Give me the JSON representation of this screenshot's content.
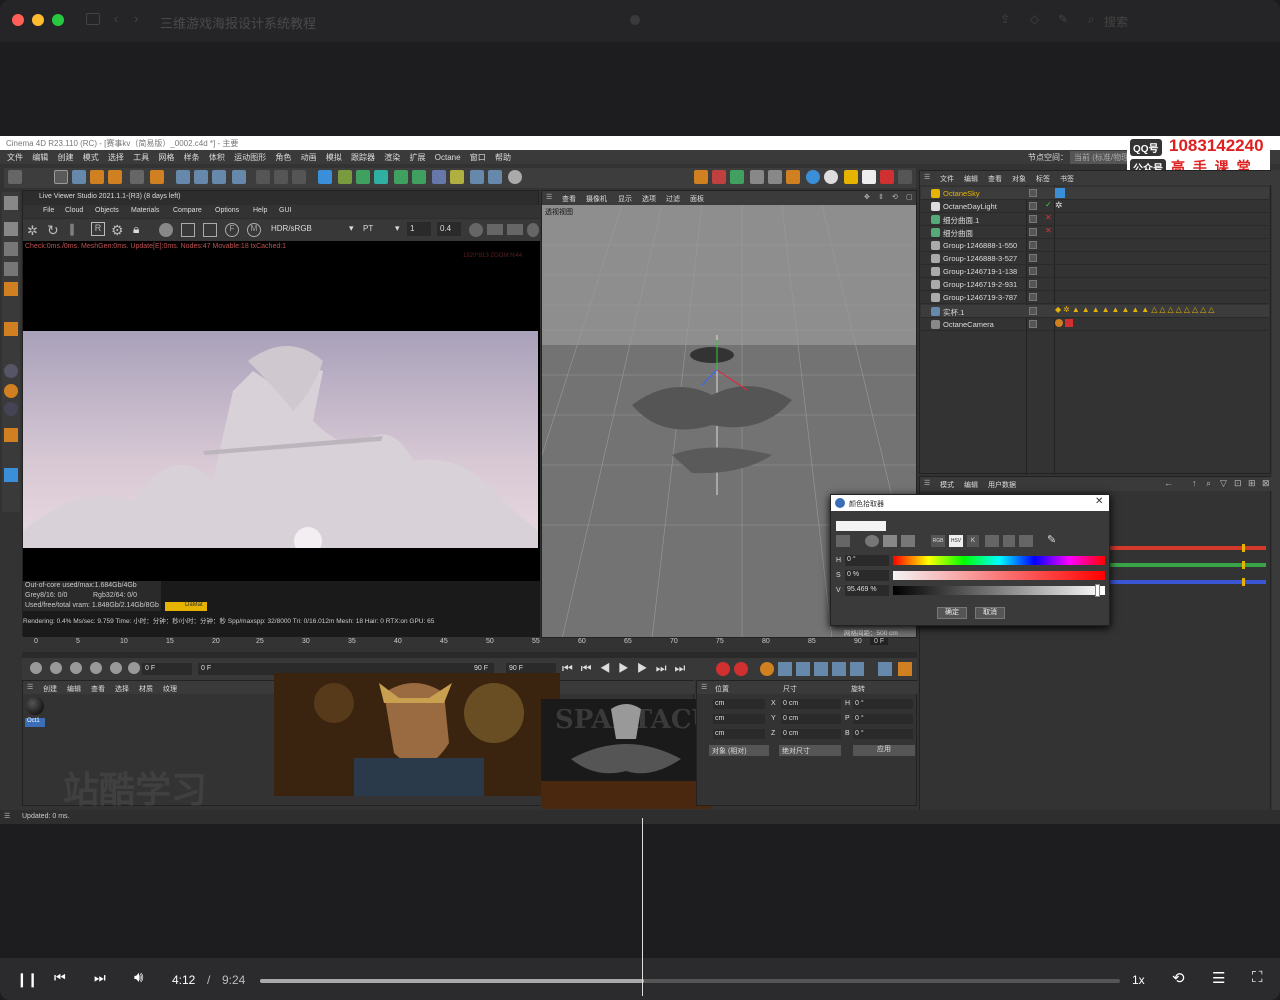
{
  "window": {
    "title": "三维游戏海报设计系统教程",
    "search_placeholder": "搜索"
  },
  "c4d": {
    "title": "Cinema 4D R23.110 (RC) - [赛事kv（简易版）_0002.c4d *] - 主要",
    "menu": [
      "文件",
      "编辑",
      "创建",
      "模式",
      "选择",
      "工具",
      "网格",
      "样条",
      "体积",
      "运动图形",
      "角色",
      "动画",
      "模拟",
      "跟踪器",
      "渲染",
      "扩展",
      "Octane",
      "窗口",
      "帮助"
    ],
    "node_space_label": "节点空间：",
    "node_space_value": "当前 (标准/物理)"
  },
  "watermark_badge": {
    "qq_label": "QQ号",
    "qq_number": "1083142240",
    "wechat_label": "公众号",
    "wechat_name": "高 手 课 堂"
  },
  "live_viewer": {
    "title": "Live Viewer Studio 2021.1.1-(R3) (8 days left)",
    "menu": [
      "File",
      "Cloud",
      "Objects",
      "Materials",
      "Compare",
      "Options",
      "Help",
      "GUI"
    ],
    "color_space": "HDR/sRGB",
    "mode": "PT",
    "value1": "1",
    "value2": "0.4",
    "status": "Check:0ms./0ms. MeshGen:0ms. Update[E]:0ms. Nodes:47 Movable:18 txCached:1",
    "zoom_text": "1920*813 ZOOM:%44",
    "stats": [
      "Out-of-core used/max:1.684Gb/4Gb",
      "Grey8/16: 0/0",
      "Rgb32/64: 0/0",
      "Used/free/total vram: 1.848Gb/2.14Gb/8Gb",
      "Rendering: 0.4%   Ms/sec: 9.759   Time: 小时：分钟：秒/小时：分钟：秒   Spp/maxspp: 32/8000   Tri: 0/16.012m   Mesh: 18   Hair: 0   RTX:on   GPU:   65"
    ],
    "daylight_tag": "DaMat"
  },
  "viewport": {
    "menu": [
      "查看",
      "摄像机",
      "显示",
      "选项",
      "过滤",
      "面板"
    ],
    "label": "透视视图",
    "grid_spacing": "网格间距：500 cm"
  },
  "object_manager": {
    "menu": [
      "文件",
      "编辑",
      "查看",
      "对象",
      "标签",
      "书签"
    ],
    "objects": [
      {
        "name": "OctaneSky",
        "color": "#e6b400"
      },
      {
        "name": "OctaneDayLight",
        "color": "#dddddd"
      },
      {
        "name": "细分曲面.1",
        "color": "#dddddd"
      },
      {
        "name": "细分曲面",
        "color": "#dddddd"
      },
      {
        "name": "Group-1246888-1-550",
        "color": "#dddddd"
      },
      {
        "name": "Group-1246888-3-527",
        "color": "#dddddd"
      },
      {
        "name": "Group-1246719-1-138",
        "color": "#dddddd"
      },
      {
        "name": "Group-1246719-2-931",
        "color": "#dddddd"
      },
      {
        "name": "Group-1246719-3-787",
        "color": "#dddddd"
      },
      {
        "name": "实杯.1",
        "color": "#dddddd"
      },
      {
        "name": "OctaneCamera",
        "color": "#dddddd"
      }
    ]
  },
  "attributes": {
    "menu": [
      "模式",
      "编辑",
      "用户数据"
    ]
  },
  "color_picker": {
    "title": "颜色拾取器",
    "h_label": "H",
    "h_value": "0 °",
    "s_label": "S",
    "s_value": "0 %",
    "v_label": "V",
    "v_value": "95.469 %",
    "ok": "确定",
    "cancel": "取消",
    "mode_rgb": "RGB",
    "mode_hsv": "HSV",
    "mode_k": "K"
  },
  "timeline": {
    "ticks": [
      "0",
      "5",
      "10",
      "15",
      "20",
      "25",
      "30",
      "35",
      "40",
      "45",
      "50",
      "55",
      "60",
      "65",
      "70",
      "75",
      "80",
      "85",
      "90"
    ],
    "current": "0 F",
    "start": "0 F",
    "min": "0 F",
    "end": "90 F",
    "max": "90 F"
  },
  "material_manager": {
    "menu": [
      "创建",
      "编辑",
      "查看",
      "选择",
      "材质",
      "纹理"
    ],
    "material": "Oct1"
  },
  "coordinates": {
    "headers": [
      "位置",
      "尺寸",
      "旋转"
    ],
    "rows": [
      {
        "a": "cm",
        "bl": "X",
        "b": "0 cm",
        "cl": "H",
        "c": "0 °"
      },
      {
        "a": "cm",
        "bl": "Y",
        "b": "0 cm",
        "cl": "P",
        "c": "0 °"
      },
      {
        "a": "cm",
        "bl": "Z",
        "b": "0 cm",
        "cl": "B",
        "c": "0 °"
      }
    ],
    "mode1": "对象 (相对)",
    "mode2": "绝对尺寸",
    "apply": "应用"
  },
  "status": "Updated: 0 ms.",
  "overlay_watermark": "站酷学习",
  "thumb_text": "SPARTACUS",
  "player": {
    "current": "4:12",
    "sep": "/",
    "duration": "9:24",
    "speed": "1x",
    "progress": 0.446
  }
}
